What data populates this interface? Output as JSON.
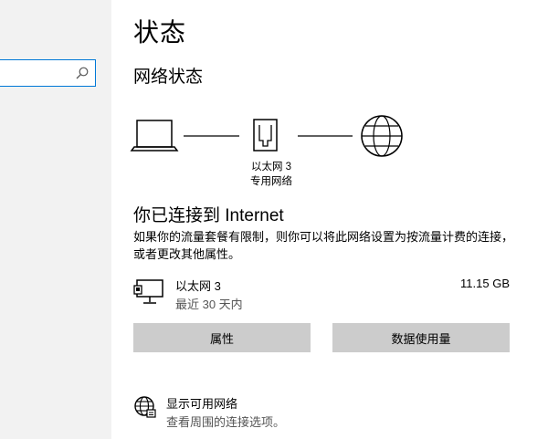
{
  "page": {
    "title": "状态",
    "network_status_heading": "网络状态"
  },
  "search": {
    "value": "",
    "icon": "search-icon"
  },
  "diagram": {
    "adapter_name": "以太网 3",
    "network_type": "专用网络",
    "icons": [
      "laptop-icon",
      "ethernet-port-icon",
      "globe-icon"
    ]
  },
  "connection": {
    "heading": "你已连接到 Internet",
    "description": "如果你的流量套餐有限制，则你可以将此网络设置为按流量计费的连接，或者更改其他属性。"
  },
  "adapter": {
    "name": "以太网 3",
    "period": "最近 30 天内",
    "usage": "11.15 GB",
    "icon": "ethernet-adapter-icon"
  },
  "buttons": {
    "properties": "属性",
    "data_usage": "数据使用量"
  },
  "available_networks": {
    "label": "显示可用网络",
    "description": "查看周围的连接选项。",
    "icon": "globe-network-icon"
  },
  "colors": {
    "sidebar_bg": "#f2f2f2",
    "accent": "#0078d7",
    "button_bg": "#cccccc"
  }
}
